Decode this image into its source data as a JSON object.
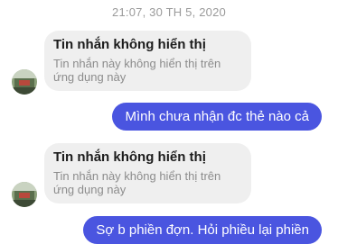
{
  "conversation": {
    "timestamp": "21:07, 30 TH 5, 2020",
    "messages": [
      {
        "direction": "incoming",
        "title": "Tin nhắn không hiển thị",
        "body": "Tin nhắn này không hiển thị trên ứng dụng này"
      },
      {
        "direction": "outgoing",
        "text": "Mình chưa nhận đc thẻ nào cả"
      },
      {
        "direction": "incoming",
        "title": "Tin nhắn không hiển thị",
        "body": "Tin nhắn này không hiển thị trên ứng dụng này"
      },
      {
        "direction": "outgoing",
        "text": "Sợ b phiền đợn. Hỏi phiều lại phiền"
      }
    ]
  },
  "colors": {
    "outgoing_bubble": "#4a55e0",
    "incoming_bubble": "#efefef",
    "timestamp_text": "#9a9a9a"
  },
  "icons": {
    "avatar": "contact-avatar-photo"
  }
}
